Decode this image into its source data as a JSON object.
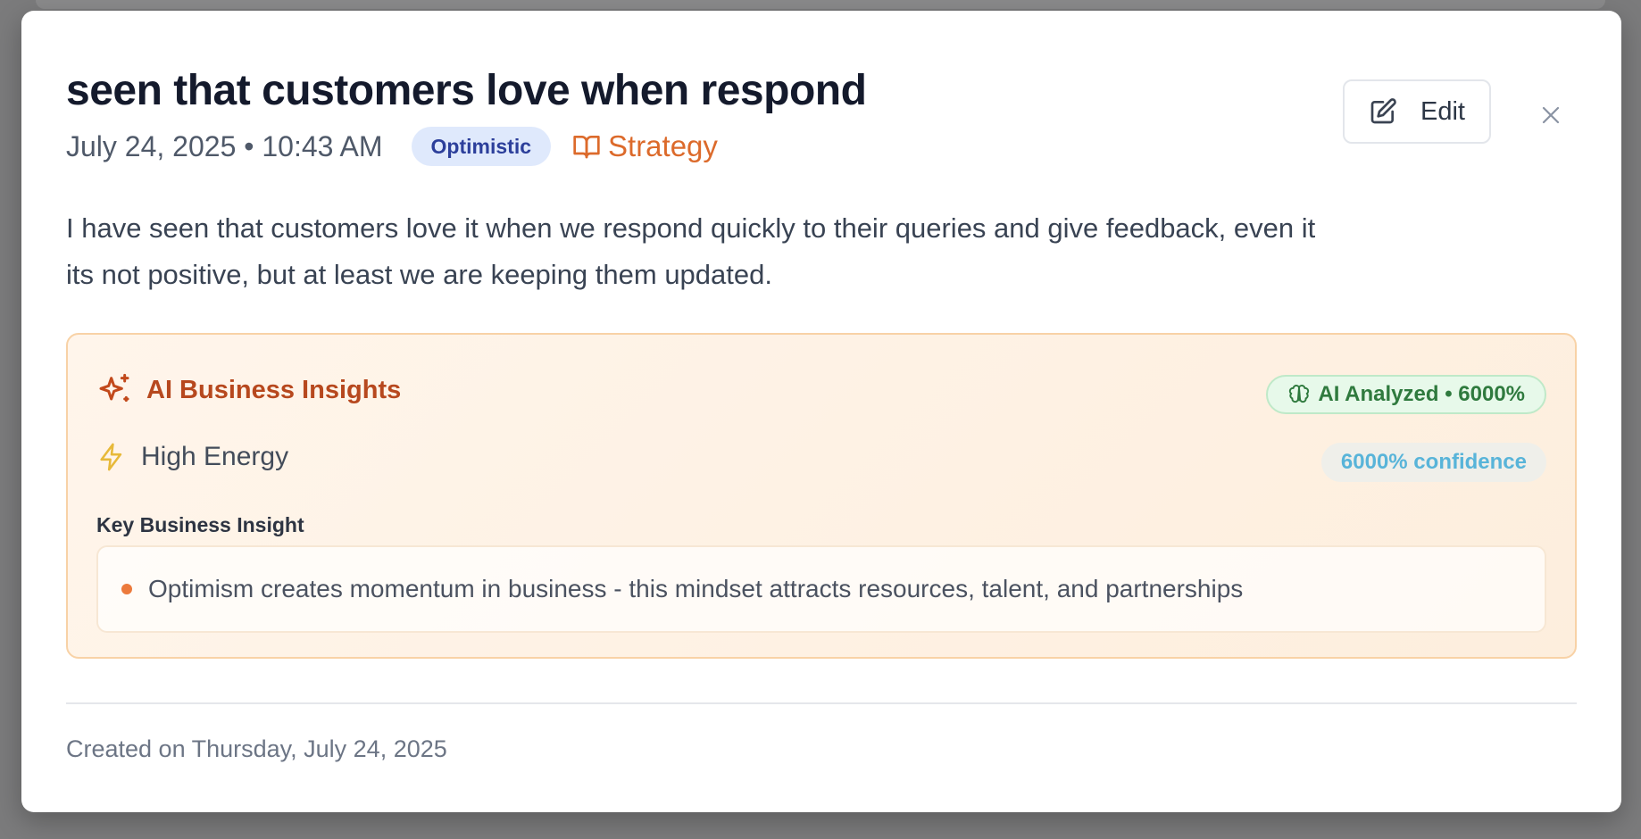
{
  "entry": {
    "title": "seen that customers love when respond",
    "date_time": "July 24, 2025 • 10:43 AM",
    "tone_badge": "Optimistic",
    "category": "Strategy",
    "body": "I have seen that customers love it when we respond quickly to their queries and give feedback, even it its not positive, but at least we are keeping them updated."
  },
  "actions": {
    "edit_label": "Edit",
    "edit_icon": "pencil-square-icon",
    "close_icon": "close-icon"
  },
  "insights": {
    "title": "AI Business Insights",
    "title_icon": "sparkles-icon",
    "analyzed_badge": "AI Analyzed • 6000%",
    "analyzed_icon": "brain-icon",
    "energy_label": "High Energy",
    "energy_icon": "lightning-icon",
    "confidence_badge": "6000% confidence",
    "key_insight_label": "Key Business Insight",
    "key_insights": [
      "Optimism creates momentum in business - this mindset attracts resources, talent, and partnerships"
    ]
  },
  "footer": {
    "created_text": "Created on Thursday, July 24, 2025"
  },
  "colors": {
    "accent_orange": "#dc6a2b",
    "insight_title": "#b7481e",
    "tone_badge_bg": "#dfe9fc",
    "tone_badge_text": "#2c3f9b",
    "analyzed_green": "#2f7a3e",
    "confidence_blue": "#58b4d9",
    "energy_yellow": "#e7b93a"
  }
}
